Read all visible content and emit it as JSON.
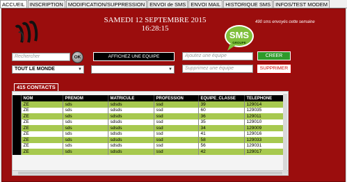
{
  "tabs": [
    "ACCUEIL",
    "INSCRIPTION",
    "MODIFICATION/SUPPRESSION",
    "ENVOI de SMS",
    "ENVOI MAIL",
    "HISTORIQUE SMS",
    "INFOS/TEST MODEM"
  ],
  "header": {
    "date": "SAMEDI 12 SEPTEMBRE 2015",
    "time": "16:28:15",
    "sms_logo_text": "SMS",
    "sms_logo_sub": "GROUPE",
    "sms_count_caption": "490 sms envoyés cette semaine"
  },
  "controls": {
    "search_placeholder": "Rechercher",
    "ok_label": "OK",
    "afficher_label": "AFFICHEZ UNE EQUIPE",
    "add_team_placeholder": "Ajoutez une équipe",
    "creer_label": "CREER",
    "select_all_value": "TOUT LE MONDE",
    "delete_team_placeholder": "Supprimez une équipe",
    "supprimer_label": "SUPPRIMER"
  },
  "contacts_label": "415 CONTACTS",
  "table": {
    "columns": [
      "NOM",
      "PRENOM",
      "MATRICULE",
      "PROFESSION",
      "EQUIPE_CLASSE",
      "TELEPHONE"
    ],
    "rows": [
      [
        "ZE",
        "sds",
        "sdsds",
        "ssd",
        "39",
        "129014"
      ],
      [
        "ZE",
        "sds",
        "sdsds",
        "ssd",
        "60",
        "129035"
      ],
      [
        "ZE",
        "sds",
        "sdsds",
        "ssd",
        "36",
        "129011"
      ],
      [
        "ZE",
        "sds",
        "sdsds",
        "ssd",
        "35",
        "129010"
      ],
      [
        "ZE",
        "sds",
        "sdsds",
        "ssd",
        "34",
        "129009"
      ],
      [
        "ZE",
        "sds",
        "sdsds",
        "ssd",
        "41",
        "129016"
      ],
      [
        "ZE",
        "sds",
        "sdsds",
        "ssd",
        "58",
        "129033"
      ],
      [
        "ZE",
        "sds",
        "sdsds",
        "ssd",
        "56",
        "129031"
      ],
      [
        "ZE",
        "sds",
        "sdsds",
        "ssd",
        "42",
        "129017"
      ]
    ]
  },
  "colors": {
    "background": "#9b0d0d",
    "row_green": "#a7c94f",
    "creer": "#2e9a2a",
    "supprimer_text": "#d00000"
  }
}
